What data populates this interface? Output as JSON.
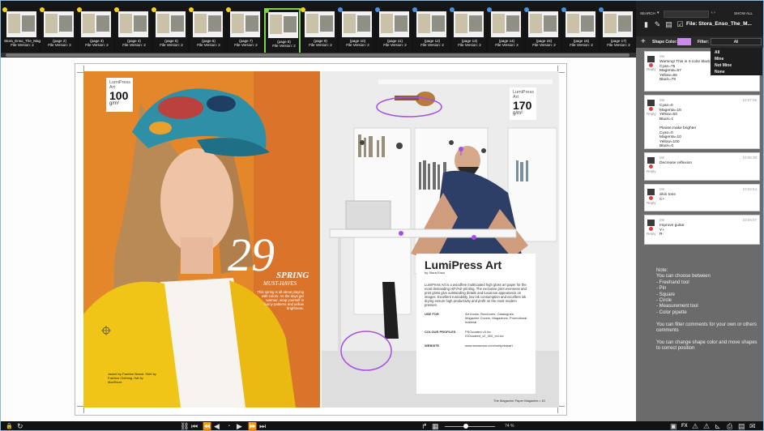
{
  "thumbnails": [
    {
      "label": "Stora_Enso_The_Mag",
      "version": "File Version: 2",
      "dot": "#f5d41a"
    },
    {
      "label": "(page 2)",
      "version": "File Version: 2",
      "dot": "#f5d41a"
    },
    {
      "label": "(page 3)",
      "version": "File Version: 2",
      "dot": "#f5d41a"
    },
    {
      "label": "(page 4)",
      "version": "File Version: 2",
      "dot": "#f5d41a"
    },
    {
      "label": "(page 5)",
      "version": "File Version: 2",
      "dot": "#f5d41a"
    },
    {
      "label": "(page 6)",
      "version": "File Version: 2",
      "dot": "#f5d41a"
    },
    {
      "label": "(page 7)",
      "version": "File Version: 2",
      "dot": "#f5d41a"
    },
    {
      "label": "(page 8)",
      "version": "File Version: 2",
      "dot": "#7fd34a"
    },
    {
      "label": "(page 9)",
      "version": "File Version: 2",
      "dot": "#f5d41a"
    },
    {
      "label": "(page 10)",
      "version": "File Version: 2",
      "dot": "#4a90e2"
    },
    {
      "label": "(page 11)",
      "version": "File Version: 2",
      "dot": "#4a90e2"
    },
    {
      "label": "(page 12)",
      "version": "File Version: 2",
      "dot": "#4a90e2"
    },
    {
      "label": "(page 13)",
      "version": "File Version: 2",
      "dot": "#4a90e2"
    },
    {
      "label": "(page 14)",
      "version": "File Version: 2",
      "dot": "#4a90e2"
    },
    {
      "label": "(page 15)",
      "version": "File Version: 2",
      "dot": "#4a90e2"
    },
    {
      "label": "(page 16)",
      "version": "File Version: 2",
      "dot": "#4a90e2"
    },
    {
      "label": "(page 17)",
      "version": "File Version: 2",
      "dot": "#4a90e2"
    }
  ],
  "header": {
    "search": "SEARCH",
    "show_all": "SHOW ALL",
    "file_name": "File: Stora_Enso_The_M..."
  },
  "toolbar": {
    "shape_color_label": "Shape Color:",
    "shape_color": "#c98be8",
    "filter_label": "Filter:",
    "filter_value": "All"
  },
  "filter_options": [
    "All",
    "Mine",
    "Not Mine",
    "None"
  ],
  "comments": [
    {
      "user": "Me",
      "time": "",
      "text": "Warning! This is 4-color black\nCyan=75\nMagenta=67\nYellow=65\nBlack=79",
      "reply": "Reply"
    },
    {
      "user": "Me",
      "time": "10:07:06",
      "text": "Cyan=0\nMagenta=16\nYellow=63\nBlack=1\n\nPlease,make brighter\nCyan=0\nMagenta=10\nYellow=100\nBlack=0",
      "reply": "Reply"
    },
    {
      "user": "Me",
      "time": "10:05:38",
      "text": "Decrease reflexion",
      "reply": "Reply"
    },
    {
      "user": "Me",
      "time": "10:04:54",
      "text": "Skin tone\nC+",
      "reply": "Reply"
    },
    {
      "user": "Me",
      "time": "10:04:07",
      "text": "Improve guitar\nY+\nR-",
      "reply": "Reply"
    }
  ],
  "note": "Note:\nYou can choose between\n- Freehand tool\n- Pin\n- Square\n- Circle\n- Measurement tool\n- Color pipette\n\nYou can filter comments for your own or others comments\n\nYou can change shape color and move shapes to correct position",
  "page_left": {
    "spec_brand": "LumiPress Art",
    "spec_weight": "100",
    "spec_unit": "g/m²",
    "headline_num": "29",
    "headline_text": "SPRING",
    "headline_sub": "MUST-HAVES",
    "blurb": "This spring is all about playing with colors. As the days get warmer, wrap yourself in funny patterns and yellow brightness.",
    "credit": "Jacket by Fashion Brand. Shirt by Fashion Clothing. Hat by MadStore."
  },
  "page_right": {
    "spec_brand": "LumiPress Art",
    "spec_weight": "170",
    "spec_unit": "g/m²",
    "ad_brand": "LumiPress Art",
    "ad_sub": "by Stora Enso",
    "ad_body": "LumiPress Art is a woodfree multicoated high gloss art paper for the most demanding HiFi/AD printing. The exclusive print evenness and print gloss give outstanding details and luxurious appearance on images. Excellent runnability, low ink consumption and excellent ink drying ensure high productivity and profit on the most modern presses.",
    "rows": [
      {
        "k": "USE FOR",
        "v": "Art books, Brochures, Catalogues, Magazine Covers, Magazines, Promotional material"
      },
      {
        "k": "COLOUR PROFILES",
        "v": "PSOcoated v3.icc ISOcoated_v2_300_eci.icc"
      },
      {
        "k": "WEBSITE",
        "v": "www.storaenso.com/lumipressart"
      }
    ],
    "footer": "The Magazine Paper Magazine • 15"
  },
  "zoom": "74 %"
}
